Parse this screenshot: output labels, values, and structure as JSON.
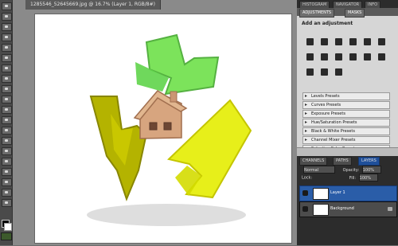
{
  "document": {
    "tab_title": "1285546_52645669.jpg @ 16.7% (Layer 1, RGB/8#)"
  },
  "panels": {
    "top_tabs": [
      "HISTOGRAM",
      "NAVIGATOR",
      "INFO"
    ],
    "adjustments_tabs": [
      "ADJUSTMENTS",
      "MASKS"
    ],
    "adjustments_title": "Add an adjustment",
    "presets": [
      "Levels Presets",
      "Curves Presets",
      "Exposure Presets",
      "Hue/Saturation Presets",
      "Black & White Presets",
      "Channel Mixer Presets",
      "Selective Color Presets"
    ]
  },
  "layers_panel": {
    "tabs": [
      "CHANNELS",
      "PATHS",
      "LAYERS"
    ],
    "blend_mode": "Normal",
    "opacity_label": "Opacity:",
    "opacity_value": "100%",
    "lock_label": "Lock:",
    "fill_label": "Fill:",
    "fill_value": "100%",
    "layers": [
      {
        "name": "Layer 1",
        "selected": true
      },
      {
        "name": "Background",
        "selected": false
      }
    ]
  },
  "colors": {
    "canvas_bg": "#ffffff",
    "recycle_green": "#7ce35b",
    "recycle_yellow": "#e7ef1a",
    "recycle_olive": "#b4b300",
    "house": "#d7a57f"
  }
}
